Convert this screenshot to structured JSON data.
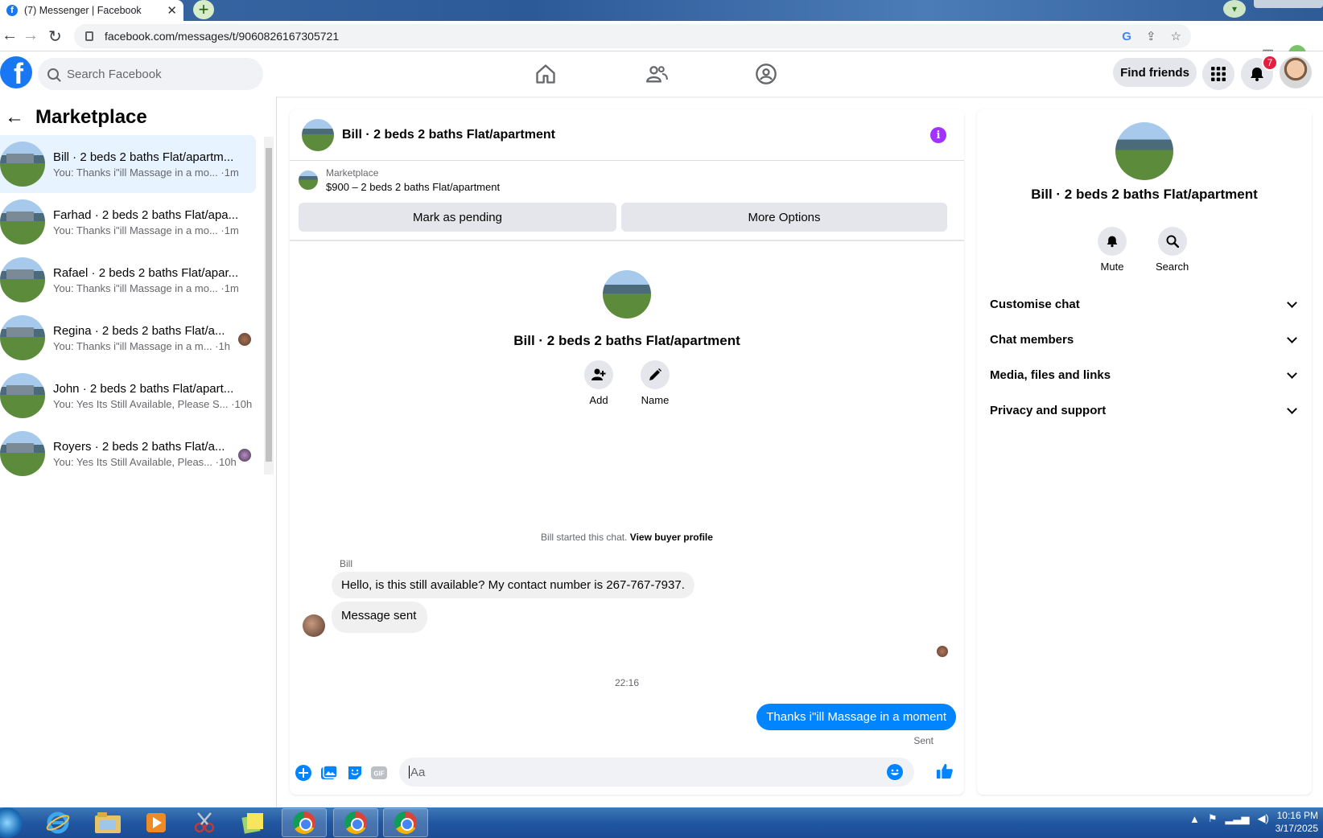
{
  "browser": {
    "tab_title": "(7) Messenger | Facebook",
    "tab_close": "✕",
    "new_tab": "+",
    "url": "facebook.com/messages/t/9060826167305721"
  },
  "header": {
    "search_placeholder": "Search Facebook",
    "find_friends": "Find friends",
    "notification_count": "7"
  },
  "sidebar": {
    "title": "Marketplace",
    "conversations": [
      {
        "title": "Bill · 2 beds 2 baths Flat/apartm...",
        "snippet": "You: Thanks i\"ill Massage in a mo...",
        "time": "·1m"
      },
      {
        "title": "Farhad · 2 beds 2 baths Flat/apa...",
        "snippet": "You: Thanks i\"ill Massage in a mo...",
        "time": "·1m"
      },
      {
        "title": "Rafael · 2 beds 2 baths Flat/apar...",
        "snippet": "You: Thanks i\"ill Massage in a mo...",
        "time": "·1m"
      },
      {
        "title": "Regina · 2 beds 2 baths Flat/a...",
        "snippet": "You: Thanks i\"ill Massage in a m...",
        "time": "·1h"
      },
      {
        "title": "John · 2 beds 2 baths Flat/apart...",
        "snippet": "You: Yes Its Still Available, Please S...",
        "time": "·10h"
      },
      {
        "title": "Royers · 2 beds 2 baths Flat/a...",
        "snippet": "You: Yes Its Still Available, Pleas...",
        "time": "·10h"
      }
    ]
  },
  "chat": {
    "title": "Bill · 2 beds 2 baths Flat/apartment",
    "marketplace_label": "Marketplace",
    "listing": "$900 – 2 beds 2 baths Flat/apartment",
    "mark_pending": "Mark as pending",
    "more_options": "More Options",
    "center_title": "Bill · 2 beds 2 baths Flat/apartment",
    "add_label": "Add",
    "name_label": "Name",
    "started_text": "Bill started this chat.",
    "view_buyer": "View buyer profile",
    "sender_name": "Bill",
    "msg1": "Hello, is this still available? My contact number is 267-767-7937.",
    "msg2": "Message sent",
    "timestamp": "22:16",
    "my_msg": "Thanks i\"ill Massage in a moment",
    "sent_status": "Sent",
    "input_placeholder": "Aa"
  },
  "details": {
    "name": "Bill · 2 beds 2 baths Flat/apartment",
    "mute": "Mute",
    "search": "Search",
    "sections": [
      "Customise chat",
      "Chat members",
      "Media, files and links",
      "Privacy and support"
    ]
  },
  "taskbar": {
    "time": "10:16 PM",
    "date": "3/17/2025"
  },
  "colors": {
    "fb_blue": "#1877f2",
    "messenger_blue": "#0084ff",
    "badge_red": "#e41e3f",
    "info_purple": "#a033ff"
  }
}
